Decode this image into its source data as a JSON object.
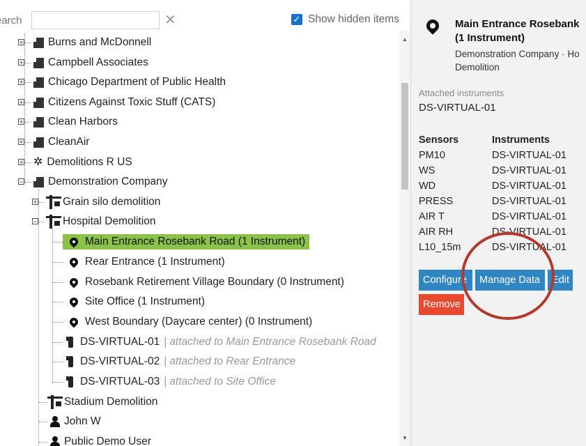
{
  "search": {
    "label": "earch",
    "placeholder": "",
    "value": ""
  },
  "show_hidden": {
    "label": "Show hidden items",
    "checked": true
  },
  "tree": {
    "companies": [
      {
        "name": "Burns and McDonnell",
        "kind": "building"
      },
      {
        "name": "Campbell Associates",
        "kind": "building"
      },
      {
        "name": "Chicago Department of Public Health",
        "kind": "building"
      },
      {
        "name": "Citizens Against Toxic Stuff (CATS)",
        "kind": "building"
      },
      {
        "name": "Clean Harbors",
        "kind": "building"
      },
      {
        "name": "CleanAir",
        "kind": "building"
      },
      {
        "name": "Demolitions R US",
        "kind": "network"
      },
      {
        "name": "Demonstration Company",
        "kind": "building"
      }
    ],
    "projects": [
      {
        "name": "Grain silo demolition"
      },
      {
        "name": "Hospital Demolition"
      }
    ],
    "locations": [
      {
        "name": "Main Entrance Rosebank Road (1 Instrument)",
        "selected": true
      },
      {
        "name": "Rear Entrance (1 Instrument)"
      },
      {
        "name": "Rosebank Retirement Village Boundary (0 Instrument)"
      },
      {
        "name": "Site Office (1 Instrument)"
      },
      {
        "name": "West Boundary (Daycare center) (0 Instrument)"
      }
    ],
    "instruments": [
      {
        "name": "DS-VIRTUAL-01",
        "separator": "|",
        "attached": "attached to Main Entrance Rosebank Road"
      },
      {
        "name": "DS-VIRTUAL-02",
        "separator": "|",
        "attached": "attached to Rear Entrance"
      },
      {
        "name": "DS-VIRTUAL-03",
        "separator": "|",
        "attached": "attached to Site Office"
      }
    ],
    "after": [
      {
        "name": "Stadium Demolition",
        "kind": "site"
      },
      {
        "name": "John W",
        "kind": "person"
      },
      {
        "name": "Public Demo User",
        "kind": "person"
      }
    ]
  },
  "detail": {
    "title_line1": "Main Entrance Rosebank",
    "title_line2": "(1 Instrument)",
    "subtitle_line1": "Demonstration Company · Ho",
    "subtitle_line2": "Demolition",
    "attached_label": "Attached instruments",
    "attached_value": "DS-VIRTUAL-01",
    "table": {
      "headers": [
        "Sensors",
        "Instruments"
      ],
      "rows": [
        [
          "PM10",
          "DS-VIRTUAL-01"
        ],
        [
          "WS",
          "DS-VIRTUAL-01"
        ],
        [
          "WD",
          "DS-VIRTUAL-01"
        ],
        [
          "PRESS",
          "DS-VIRTUAL-01"
        ],
        [
          "AIR T",
          "DS-VIRTUAL-01"
        ],
        [
          "AIR RH",
          "DS-VIRTUAL-01"
        ],
        [
          "L10_15m",
          "DS-VIRTUAL-01"
        ]
      ]
    },
    "buttons": {
      "configure": "Configure",
      "manage_data": "Manage Data",
      "edit": "Edit",
      "remove": "Remove"
    }
  },
  "colors": {
    "selected_bg": "#8bc34a",
    "button_blue": "#2f86c3",
    "button_red": "#e8492f",
    "annotation": "#b23a2c",
    "checkbox": "#1a73c9"
  }
}
